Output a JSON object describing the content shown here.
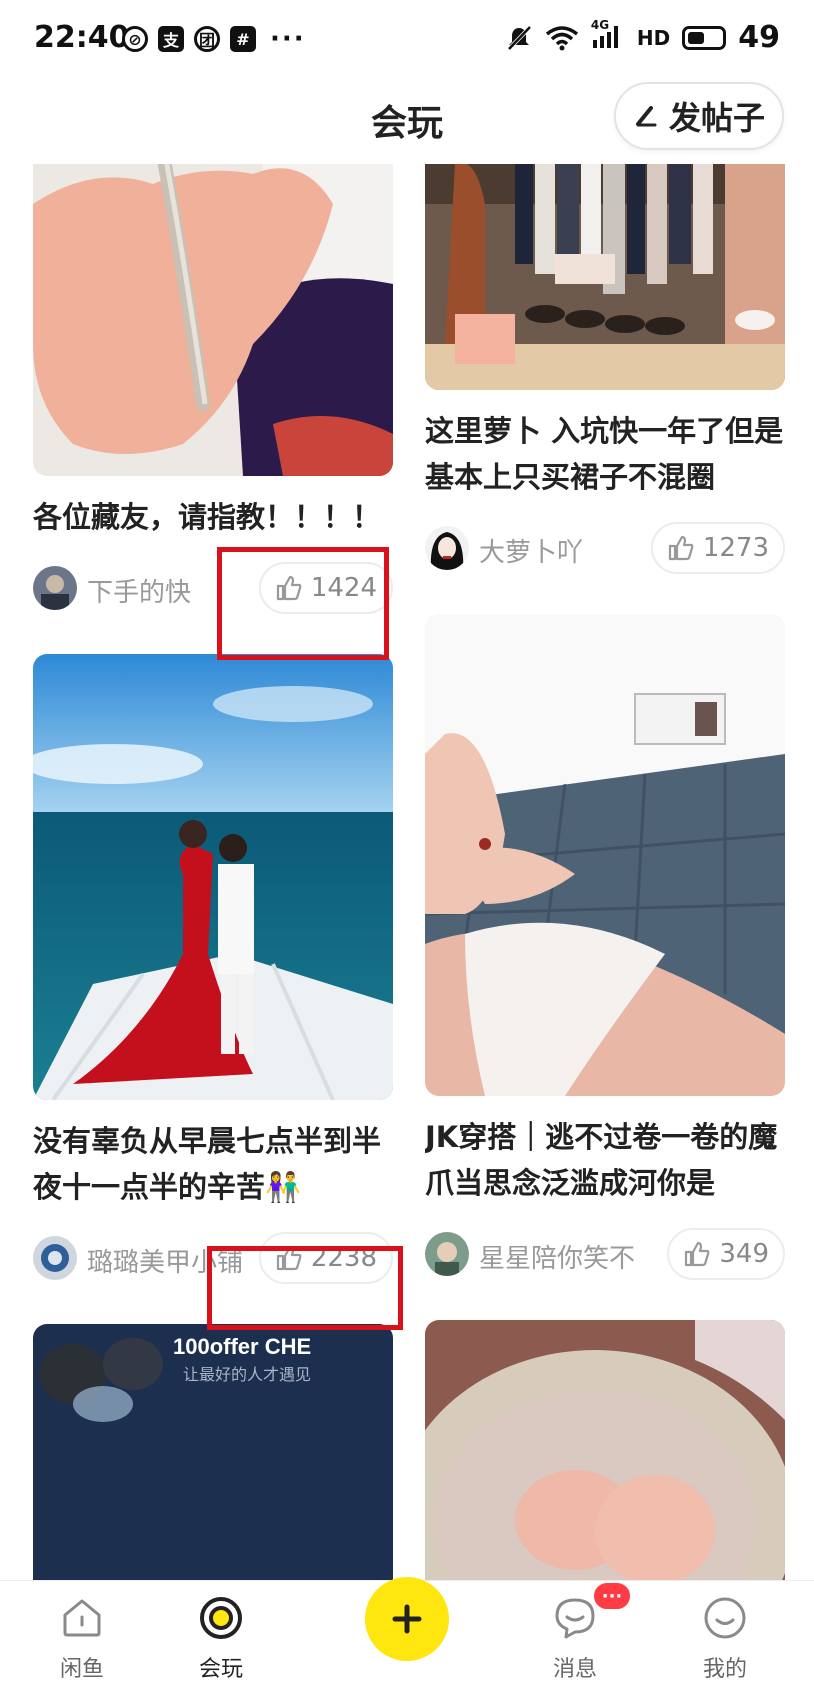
{
  "status_bar": {
    "time": "22:40",
    "app_icons": [
      "do-not-disturb-icon",
      "pay-icon",
      "group-icon",
      "grid-icon"
    ],
    "more": "···",
    "network": "4G",
    "hd": "HD",
    "battery": "49",
    "battery_fraction": 0.49
  },
  "header": {
    "title": "会玩",
    "post_button_label": "发帖子"
  },
  "feed": {
    "left": [
      {
        "title": "各位藏友，请指教！！！！",
        "author": "下手的快",
        "likes": "1424",
        "image": "hand-holding-fish-photo"
      },
      {
        "title": "没有辜负从早晨七点半到半夜十一点半的辛苦👫",
        "author": "璐璐美甲小铺",
        "likes": "2238",
        "image": "couple-on-yacht-photo"
      },
      {
        "title": "",
        "author": "",
        "likes": "",
        "image": "earbuds-on-mousepad-photo",
        "image_text": "100offer CHE",
        "image_subtext": "让最好的人才遇见"
      }
    ],
    "right": [
      {
        "title": "这里萝卜 入坑快一年了但是基本上只买裙子不混圈",
        "author": "大萝卜吖",
        "likes": "1273",
        "image": "wardrobe-photo"
      },
      {
        "title": "JK穿搭｜逃不过卷一卷的魔爪当思念泛滥成河你是",
        "author": "星星陪你笑不",
        "likes": "349",
        "image": "jk-uniform-photo"
      },
      {
        "title": "",
        "author": "",
        "likes": "",
        "image": "stone-bowl-photo"
      }
    ]
  },
  "bottom_nav": {
    "items": [
      {
        "label": "闲鱼",
        "icon": "home-icon"
      },
      {
        "label": "会玩",
        "icon": "play-icon"
      },
      {
        "label": "",
        "icon": "plus-icon"
      },
      {
        "label": "消息",
        "icon": "message-icon"
      },
      {
        "label": "我的",
        "icon": "profile-icon"
      }
    ],
    "message_badge": "···"
  },
  "colors": {
    "accent": "#ffe60f",
    "highlight": "#d8111b",
    "badge": "#ff3b44"
  }
}
